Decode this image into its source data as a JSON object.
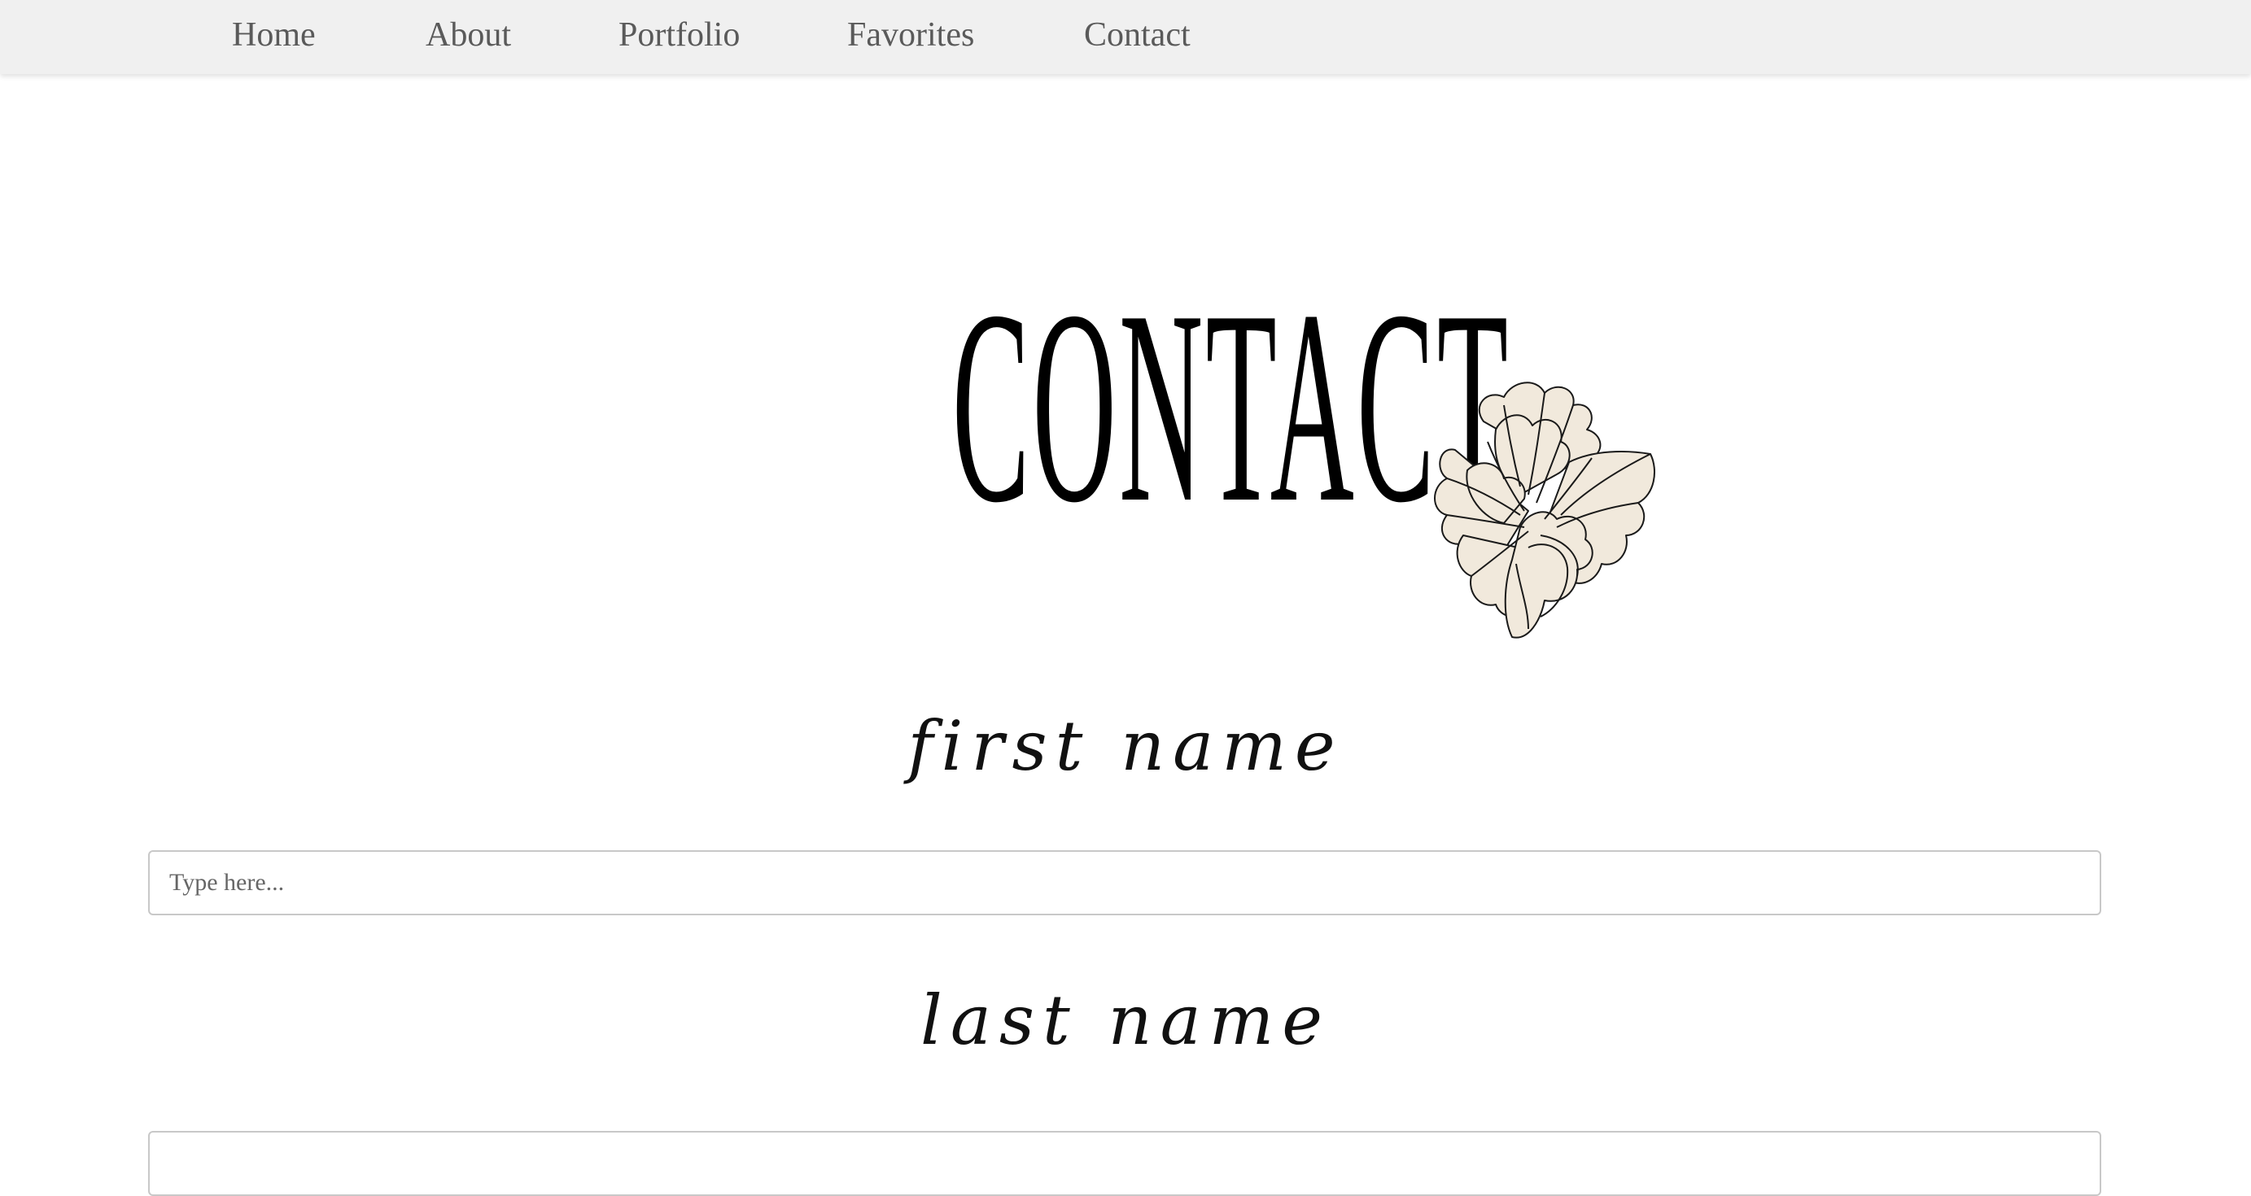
{
  "nav": {
    "items": [
      {
        "label": "Home"
      },
      {
        "label": "About"
      },
      {
        "label": "Portfolio"
      },
      {
        "label": "Favorites"
      },
      {
        "label": "Contact"
      }
    ]
  },
  "hero": {
    "title": "CONTACT",
    "decoration_icon": "peony-flower-icon",
    "flower_fill": "#f1e9dc"
  },
  "form": {
    "first_name": {
      "label": "first name",
      "placeholder": "Type here..."
    },
    "last_name": {
      "label": "last name",
      "placeholder": ""
    }
  },
  "colors": {
    "nav_background": "#f0f0f0",
    "nav_text": "#5a5a5a",
    "page_background": "#ffffff",
    "input_border": "#c8c8c8"
  }
}
